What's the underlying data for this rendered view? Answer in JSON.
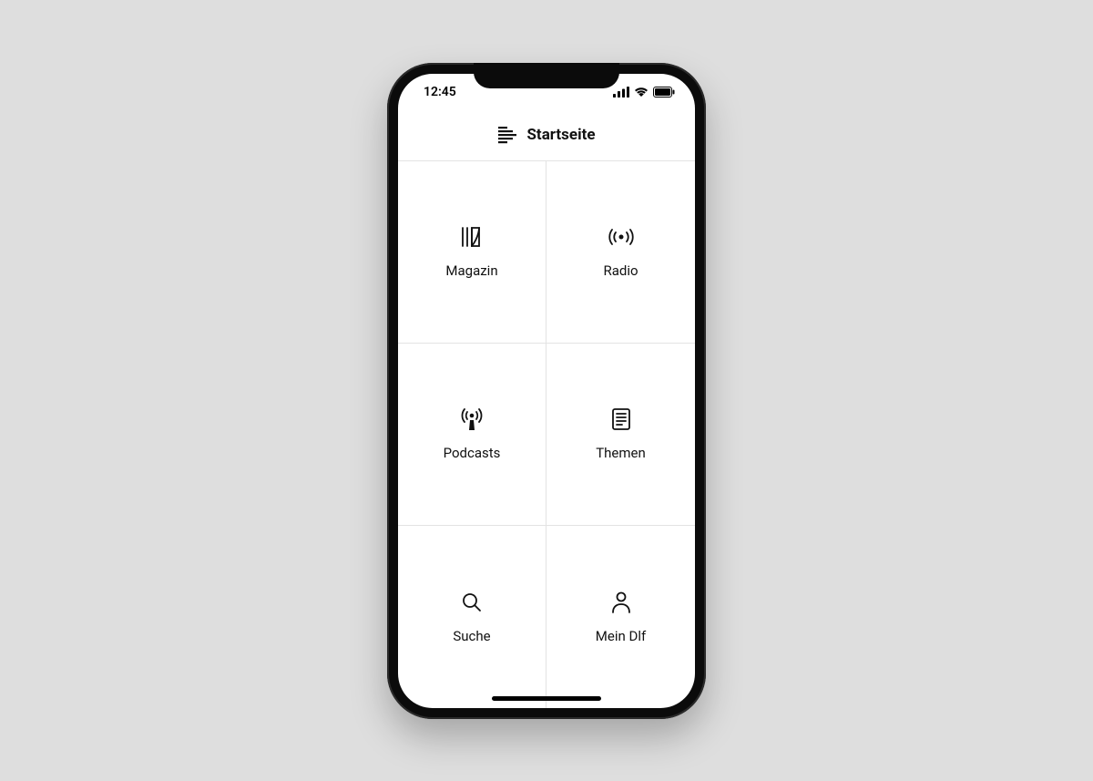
{
  "status": {
    "time": "12:45"
  },
  "header": {
    "title": "Startseite"
  },
  "tiles": {
    "0": {
      "label": "Magazin"
    },
    "1": {
      "label": "Radio"
    },
    "2": {
      "label": "Podcasts"
    },
    "3": {
      "label": "Themen"
    },
    "4": {
      "label": "Suche"
    },
    "5": {
      "label": "Mein Dlf"
    }
  }
}
